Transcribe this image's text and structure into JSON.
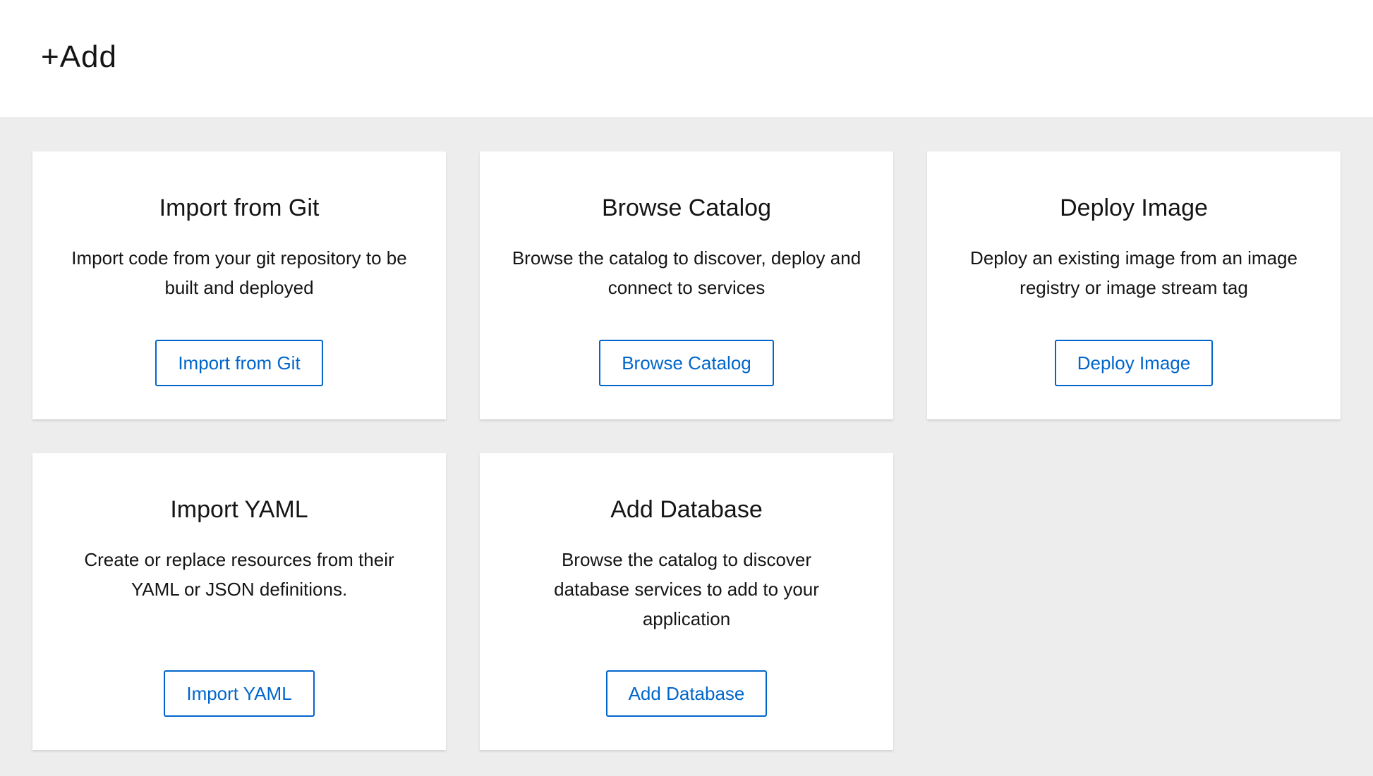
{
  "header": {
    "title": "+Add"
  },
  "colors": {
    "accent": "#0066cc",
    "background": "#ededed"
  },
  "cards": [
    {
      "title": "Import from Git",
      "description": "Import code from your git repository to be built and deployed",
      "button": "Import from Git"
    },
    {
      "title": "Browse Catalog",
      "description": "Browse the catalog to discover, deploy and connect to services",
      "button": "Browse Catalog"
    },
    {
      "title": "Deploy Image",
      "description": "Deploy an existing image from an image registry or image stream tag",
      "button": "Deploy Image"
    },
    {
      "title": "Import YAML",
      "description": "Create or replace resources from their YAML or JSON definitions.",
      "button": "Import YAML"
    },
    {
      "title": "Add Database",
      "description": "Browse the catalog to discover database services to add to your application",
      "button": "Add Database"
    }
  ]
}
